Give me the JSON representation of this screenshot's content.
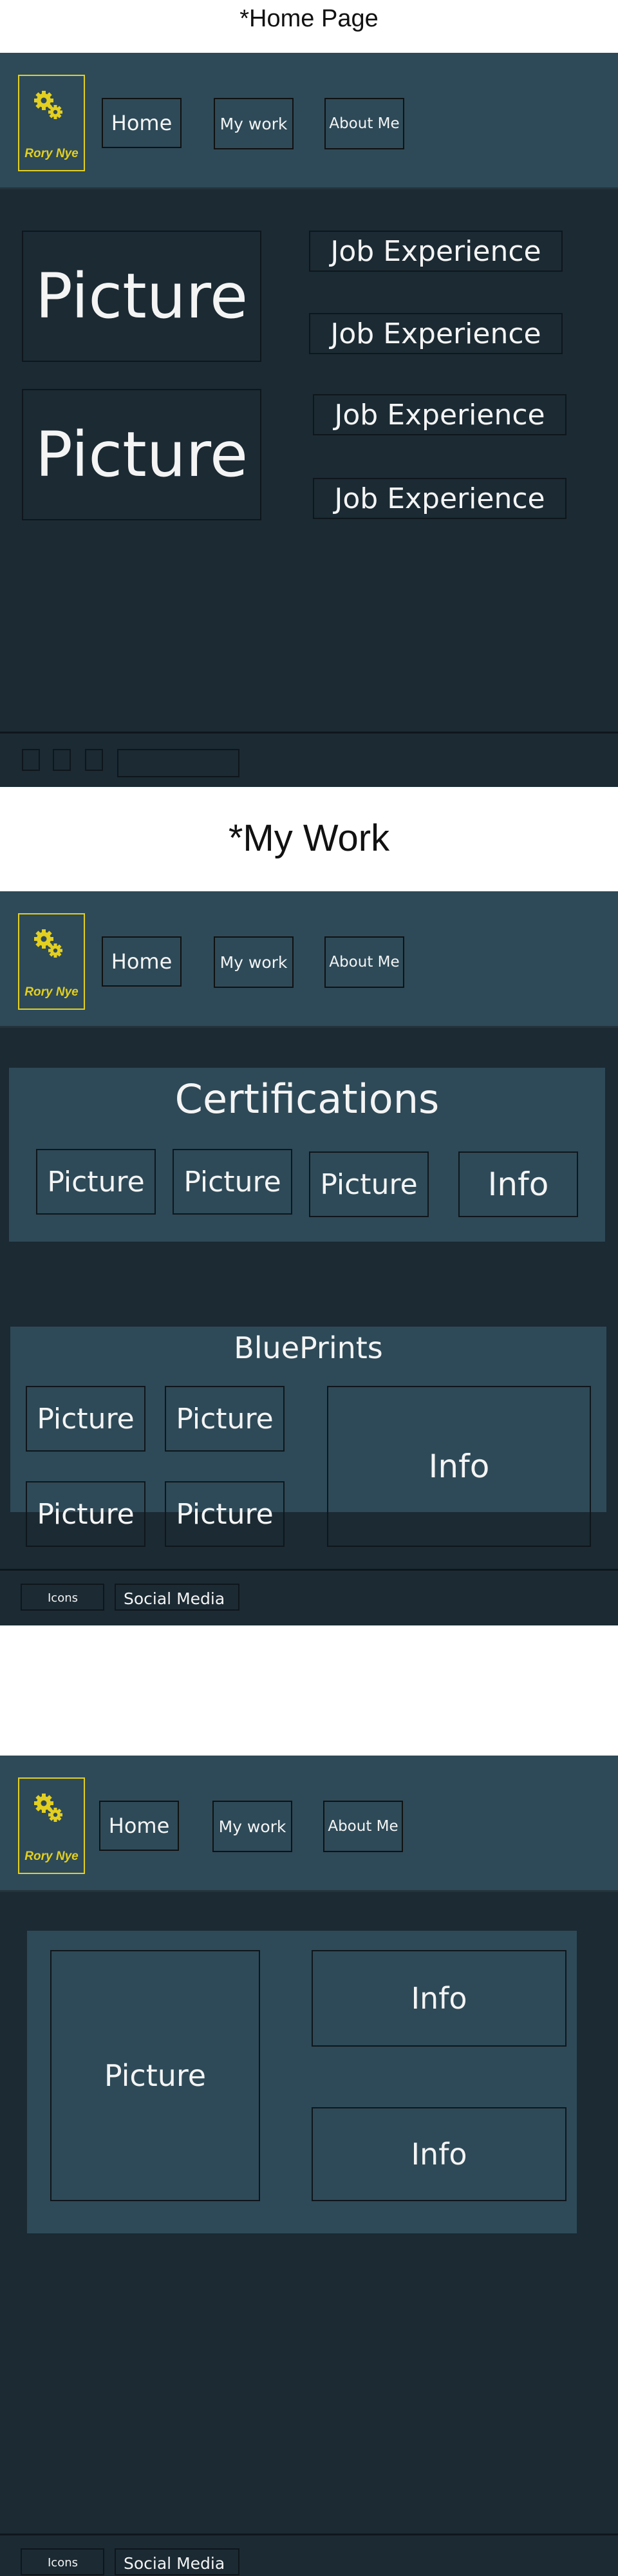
{
  "colors": {
    "dark_bg": "#1b2a33",
    "panel_bg": "#2e4a58",
    "logo_yellow": "#e3cf1f",
    "border": "#0f161b"
  },
  "home": {
    "heading": "*Home Page",
    "logo_text": "Rory Nye",
    "nav": {
      "home": "Home",
      "work": "My work",
      "about": "About  Me"
    },
    "pictures": [
      "Picture",
      "Picture"
    ],
    "jobs": [
      "Job Experience",
      "Job Experience",
      "Job Experience",
      "Job Experience"
    ]
  },
  "work": {
    "heading": "*My Work",
    "logo_text": "Rory Nye",
    "nav": {
      "home": "Home",
      "work": "My work",
      "about": "About  Me"
    },
    "certifications": {
      "title": "Certifications",
      "items": [
        "Picture",
        "Picture",
        "Picture"
      ],
      "info": "Info"
    },
    "blueprints": {
      "title": "BluePrints",
      "pictures": [
        "Picture",
        "Picture",
        "Picture",
        "Picture"
      ],
      "info": "Info"
    },
    "footer": {
      "icons": "Icons",
      "social": "Social Media"
    }
  },
  "about": {
    "logo_text": "Rory Nye",
    "nav": {
      "home": "Home",
      "work": "My work",
      "about": "About  Me"
    },
    "picture": "Picture",
    "infos": [
      "Info",
      "Info"
    ],
    "footer": {
      "icons": "Icons",
      "social": "Social Media"
    }
  }
}
